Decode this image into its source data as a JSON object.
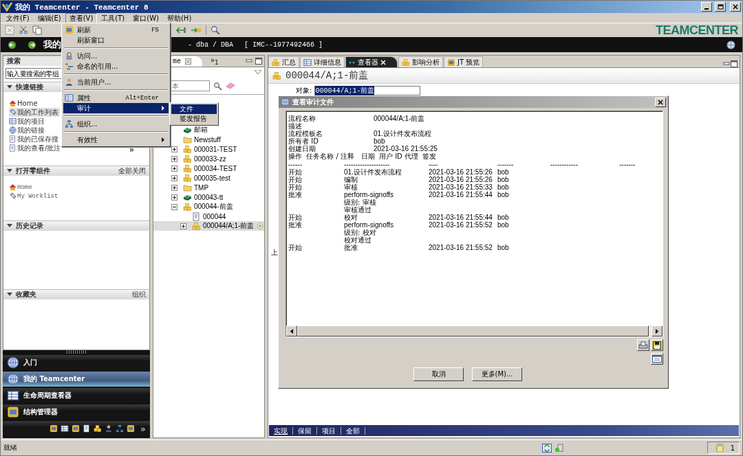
{
  "window": {
    "title": "我的 Teamcenter - Teamcenter 8"
  },
  "menu_bar": [
    {
      "label": "文件(F)",
      "selected": false
    },
    {
      "label": "编辑(E)",
      "selected": false
    },
    {
      "label": "查看(V)",
      "selected": true
    },
    {
      "label": "工具(T)",
      "selected": false
    },
    {
      "label": "窗口(W)",
      "selected": false
    },
    {
      "label": "帮助(H)",
      "selected": false
    }
  ],
  "brand": {
    "logo": "TEAMCENTER"
  },
  "location_bar": {
    "title": "我的",
    "context": "- dba / DBA",
    "server": "[ IMC--1977492466 ]"
  },
  "view_menu": [
    {
      "kind": "item",
      "label": "刷新",
      "shortcut": "F5",
      "selected": false
    },
    {
      "kind": "item",
      "label": "刷新窗口",
      "selected": false
    },
    {
      "kind": "separator"
    },
    {
      "kind": "item",
      "label": "访问...",
      "selected": false
    },
    {
      "kind": "item",
      "label": "命名的引用...",
      "selected": false
    },
    {
      "kind": "separator"
    },
    {
      "kind": "item",
      "label": "当前用户...",
      "selected": false
    },
    {
      "kind": "separator"
    },
    {
      "kind": "item",
      "label": "属性",
      "shortcut": "Alt+Enter",
      "selected": false
    },
    {
      "kind": "submenu",
      "label": "审计",
      "selected": true
    },
    {
      "kind": "separator"
    },
    {
      "kind": "item",
      "label": "组织...",
      "selected": false
    },
    {
      "kind": "separator"
    },
    {
      "kind": "submenu",
      "label": "有效性",
      "selected": false
    }
  ],
  "audit_submenu": [
    {
      "label": "文件",
      "selected": true
    },
    {
      "label": "签发报告",
      "selected": false
    }
  ],
  "search_panel": {
    "title": "搜索",
    "placeholder": "输入要搜索的零组"
  },
  "quick_links": {
    "title": "快速链接",
    "more": "»",
    "items": [
      {
        "label": "Home",
        "selected": false
      },
      {
        "label": "我的工作列表",
        "selected": true
      },
      {
        "label": "我的项目",
        "selected": false
      },
      {
        "label": "我的链接",
        "selected": false
      },
      {
        "label": "我的已保存搜",
        "selected": false
      },
      {
        "label": "我的查看/批注",
        "selected": false
      }
    ]
  },
  "open_items": {
    "title": "打开零组件",
    "action": "全部关闭",
    "items": [
      "Home",
      "My Worklist"
    ]
  },
  "history": {
    "title": "历史记录"
  },
  "favorites": {
    "title": "收藏夹",
    "action": "组织"
  },
  "applications": {
    "more": "»",
    "items": [
      {
        "label": "入门",
        "selected": false
      },
      {
        "label": "我的 Teamcenter",
        "selected": true
      },
      {
        "label": "生命周期查看器",
        "selected": false
      },
      {
        "label": "结构管理器",
        "selected": false
      }
    ]
  },
  "home_view": {
    "tab": "me",
    "overflow": "»$_{1}$",
    "search_placeholder": "本",
    "tree": [
      {
        "label": "邮箱",
        "kind": "mailbox",
        "selected": false
      },
      {
        "label": "Newstuff",
        "kind": "folder",
        "selected": false
      },
      {
        "label": "000031-TEST",
        "kind": "item",
        "expanded": false,
        "selected": false
      },
      {
        "label": "000033-zz",
        "kind": "item",
        "expanded": false,
        "selected": false
      },
      {
        "label": "000034-TEST",
        "kind": "item",
        "expanded": false,
        "selected": false
      },
      {
        "label": "000035-test",
        "kind": "item",
        "expanded": false,
        "selected": false
      },
      {
        "label": "TMP",
        "kind": "folder",
        "expanded": false,
        "selected": false
      },
      {
        "label": "000043-tt",
        "kind": "dataset",
        "expanded": false,
        "selected": false
      },
      {
        "label": "000044-前盖",
        "kind": "item",
        "expanded": true,
        "selected": false,
        "children": [
          {
            "label": "000044",
            "kind": "form",
            "selected": false
          },
          {
            "label": "000044/A;1-前盖",
            "kind": "revision",
            "expanded": false,
            "selected": true
          }
        ]
      }
    ]
  },
  "editor": {
    "tabs": [
      {
        "label": "汇总",
        "selected": false
      },
      {
        "label": "详细信息",
        "selected": false
      },
      {
        "label": "查看器",
        "selected": true
      },
      {
        "label": "影响分析",
        "selected": false
      },
      {
        "label": "JT 预览",
        "selected": false
      }
    ],
    "title": "000044/A;1-前盖",
    "object_label": "对象:",
    "object_value": "000044/A;1-前盖",
    "cut_label": "上",
    "bottom_tabs": [
      {
        "label": "实现",
        "selected": true
      },
      {
        "label": "保留",
        "selected": false
      },
      {
        "label": "项目",
        "selected": false
      },
      {
        "label": "全部",
        "selected": false
      }
    ]
  },
  "audit_dialog": {
    "title": "查看审计文件",
    "fields": [
      {
        "label": "流程名称",
        "value": "000044/A;1-前盖"
      },
      {
        "label": "描述"
      },
      {
        "label": "流程模板名",
        "value": "01.设计件发布流程"
      },
      {
        "label": "所有者 ID",
        "value": "bob"
      },
      {
        "label": "创建日期",
        "value": "2021-03-16 21:55:25"
      }
    ],
    "column_header": "操作  任务名称 / 注释   日期  用户 ID 代理  签发",
    "rules": [
      "------",
      "--------------------",
      "----",
      "-------",
      "------------",
      "-------"
    ],
    "entries": [
      {
        "action": "开始",
        "task": "01.设计件发布流程",
        "date": "2021-03-16 21:55:26",
        "user": "bob"
      },
      {
        "action": "开始",
        "task": "编制",
        "date": "2021-03-16 21:55:26",
        "user": "bob"
      },
      {
        "action": "开始",
        "task": "审核",
        "date": "2021-03-16 21:55:33",
        "user": "bob"
      },
      {
        "action": "批准",
        "task": "perform-signoffs",
        "date": "2021-03-16 21:55:44",
        "user": "bob",
        "notes": [
          "级别: 审核",
          "审核通过"
        ]
      },
      {
        "action": "开始",
        "task": "校对",
        "date": "2021-03-16 21:55:44",
        "user": "bob"
      },
      {
        "action": "批准",
        "task": "perform-signoffs",
        "date": "2021-03-16 21:55:52",
        "user": "bob",
        "notes": [
          "级别: 校对",
          "校对通过"
        ]
      },
      {
        "action": "开始",
        "task": "批准",
        "date": "2021-03-16 21:55:52",
        "user": "bob"
      }
    ],
    "buttons": [
      "取消",
      "更多(M)..."
    ]
  },
  "status_bar": {
    "text": "就绪",
    "count": "1"
  }
}
